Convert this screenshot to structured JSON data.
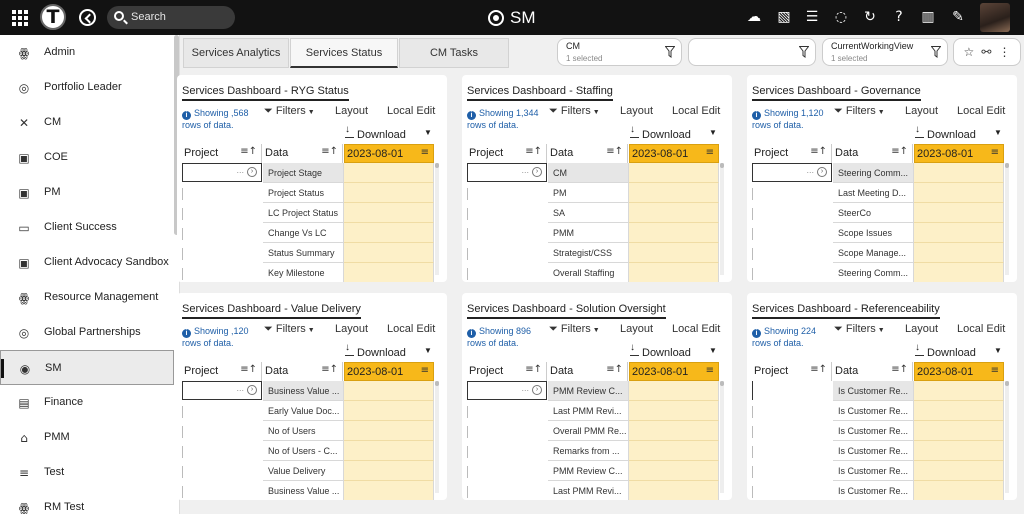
{
  "topbar": {
    "logo_letter": "T",
    "search_placeholder": "Search",
    "app_title": "SM"
  },
  "sidebar": {
    "items": [
      {
        "label": "Admin",
        "icon": "people-group-icon",
        "glyph": "ꙮ"
      },
      {
        "label": "Portfolio Leader",
        "icon": "compass-icon",
        "glyph": "◎"
      },
      {
        "label": "CM",
        "icon": "network-icon",
        "glyph": "✕"
      },
      {
        "label": "COE",
        "icon": "briefcase-icon",
        "glyph": "▣"
      },
      {
        "label": "PM",
        "icon": "briefcase-icon",
        "glyph": "▣"
      },
      {
        "label": "Client Success",
        "icon": "ticket-icon",
        "glyph": "▭"
      },
      {
        "label": "Client Advocacy Sandbox",
        "icon": "briefcase-icon",
        "glyph": "▣"
      },
      {
        "label": "Resource Management",
        "icon": "people-group-icon",
        "glyph": "ꙮ"
      },
      {
        "label": "Global Partnerships",
        "icon": "compass-icon",
        "glyph": "◎"
      },
      {
        "label": "SM",
        "icon": "radio-target-icon",
        "glyph": "◉"
      },
      {
        "label": "Finance",
        "icon": "money-icon",
        "glyph": "▤"
      },
      {
        "label": "PMM",
        "icon": "bank-icon",
        "glyph": "⌂"
      },
      {
        "label": "Test",
        "icon": "list-icon",
        "glyph": "≡"
      },
      {
        "label": "RM Test",
        "icon": "people-group-icon",
        "glyph": "ꙮ"
      }
    ]
  },
  "tabs": [
    {
      "label": "Services Analytics"
    },
    {
      "label": "Services Status"
    },
    {
      "label": "CM Tasks"
    }
  ],
  "filters": {
    "cm": {
      "label": "CM",
      "sub": "1 selected"
    },
    "blank": {
      "label": "",
      "sub": ""
    },
    "view": {
      "label": "CurrentWorkingView",
      "sub": "1 selected"
    }
  },
  "panel_common": {
    "filters": "Filters",
    "layout": "Layout",
    "local_edit": "Local Edit",
    "download": "Download",
    "col_project": "Project",
    "col_data": "Data",
    "col_date": "2023-08-01"
  },
  "panels": [
    {
      "title": "Services Dashboard - RYG Status",
      "showing": "Showing ,568 rows of data.",
      "rows": [
        "Project Stage",
        "Project Status",
        "LC Project Status",
        "Change Vs LC",
        "Status Summary",
        "Key Milestone"
      ]
    },
    {
      "title": "Services Dashboard - Staffing",
      "showing": "Showing 1,344 rows of data.",
      "rows": [
        "CM",
        "PM",
        "SA",
        "PMM",
        "Strategist/CSS",
        "Overall Staffing"
      ]
    },
    {
      "title": "Services Dashboard - Governance",
      "showing": "Showing 1,120 rows of data.",
      "rows": [
        "Steering Comm...",
        "Last Meeting D...",
        "SteerCo",
        "Scope Issues",
        "Scope Manage...",
        "Steering Comm..."
      ]
    },
    {
      "title": "Services Dashboard - Value Delivery",
      "showing": "Showing ,120 rows of data.",
      "rows": [
        "Business Value ...",
        "Early Value Doc...",
        "No of Users",
        "No of Users - C...",
        "Value Delivery",
        "Business Value ..."
      ]
    },
    {
      "title": "Services Dashboard - Solution Oversight",
      "showing": "Showing 896 rows of data.",
      "rows": [
        "PMM Review C...",
        "Last PMM Revi...",
        "Overall PMM Re...",
        "Remarks from ...",
        "PMM Review C...",
        "Last PMM Revi..."
      ]
    },
    {
      "title": "Services Dashboard - Referenceability",
      "showing": "Showing 224 rows of data.",
      "rows": [
        "Is Customer Re...",
        "Is Customer Re...",
        "Is Customer Re...",
        "Is Customer Re...",
        "Is Customer Re...",
        "Is Customer Re..."
      ]
    }
  ]
}
